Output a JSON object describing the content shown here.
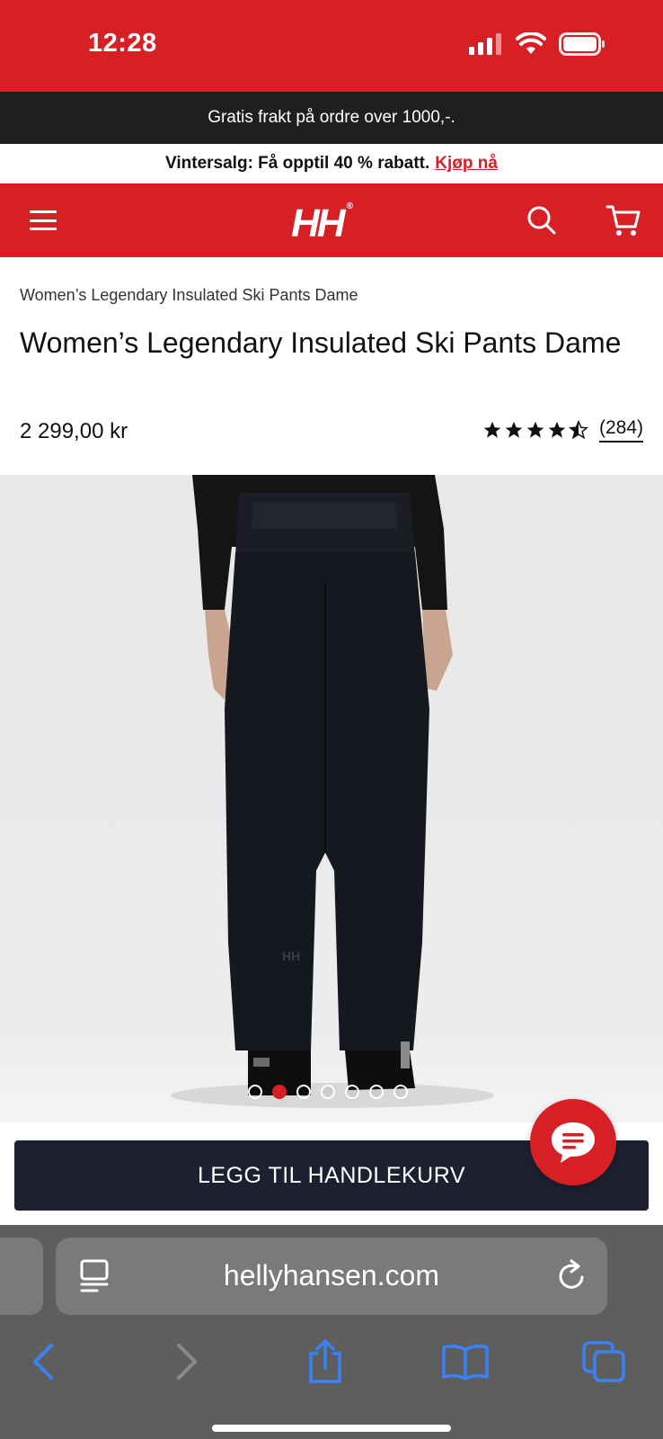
{
  "status_bar": {
    "time": "12:28"
  },
  "promo": {
    "shipping_text": "Gratis frakt på ordre over 1000,-.",
    "sale_text": "Vintersalg: Få opptil 40 % rabatt.",
    "sale_link": "Kjøp nå"
  },
  "header": {
    "logo": "HH",
    "logo_mark": "®"
  },
  "product": {
    "breadcrumb": "Women’s Legendary Insulated Ski Pants Dame",
    "title": "Women’s Legendary Insulated Ski Pants Dame",
    "price": "2 299,00 kr",
    "rating": 4.5,
    "review_count": "(284)"
  },
  "gallery": {
    "image_count": 7,
    "active_index": 1
  },
  "cart": {
    "add_label": "LEGG TIL HANDLEKURV"
  },
  "browser": {
    "url": "hellyhansen.com"
  },
  "colors": {
    "brand_red": "#d71f26",
    "button_dark": "#1d2030",
    "promo_dark": "#1f1f1f",
    "link_blue": "#3b82f6"
  }
}
